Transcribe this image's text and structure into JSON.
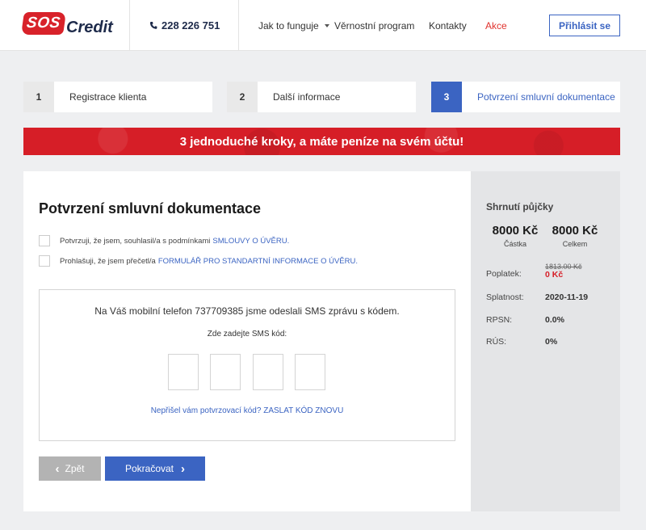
{
  "header": {
    "logo_badge": "SOS",
    "logo_word": "Credit",
    "phone": "228 226 751",
    "nav": {
      "how_it_works": "Jak to funguje",
      "loyalty": "Věrnostní program",
      "contacts": "Kontakty",
      "promo": "Akce"
    },
    "login_label": "Přihlásit se"
  },
  "steps": [
    {
      "num": "1",
      "label": "Registrace klienta"
    },
    {
      "num": "2",
      "label": "Další informace"
    },
    {
      "num": "3",
      "label": "Potvrzení smluvní dokumentace"
    }
  ],
  "banner": "3 jednoduché kroky, a máte peníze na svém účtu!",
  "main": {
    "title": "Potvrzení smluvní dokumentace",
    "check1_text": "Potvrzuji, že jsem, souhlasil/a s podmínkami",
    "check1_link": "SMLOUVY O ÚVĚRU.",
    "check2_text": "Prohlašuji, že jsem přečetl/a",
    "check2_link": "FORMULÁŘ PRO STANDARTNÍ INFORMACE O ÚVĚRU.",
    "sms_message": "Na Váš mobilní telefon 737709385 jsme odeslali SMS zprávu s kódem.",
    "sms_label": "Zde zadejte SMS kód:",
    "resend": "Nepřišel vám potvrzovací kód? ZASLAT KÓD ZNOVU",
    "back_label": "Zpět",
    "next_label": "Pokračovat"
  },
  "summary": {
    "title": "Shrnutí půjčky",
    "amount_value": "8000 Kč",
    "amount_label": "Částka",
    "total_value": "8000 Kč",
    "total_label": "Celkem",
    "fee_label": "Poplatek:",
    "fee_old": "1813.00 Kč",
    "fee_new": "0 Kč",
    "due_label": "Splatnost:",
    "due_value": "2020-11-19",
    "rpsn_label": "RPSN:",
    "rpsn_value": "0.0%",
    "rus_label": "RÚS:",
    "rus_value": "0%"
  },
  "colors": {
    "brand_red": "#d61e27",
    "accent_blue": "#3b64c2"
  }
}
